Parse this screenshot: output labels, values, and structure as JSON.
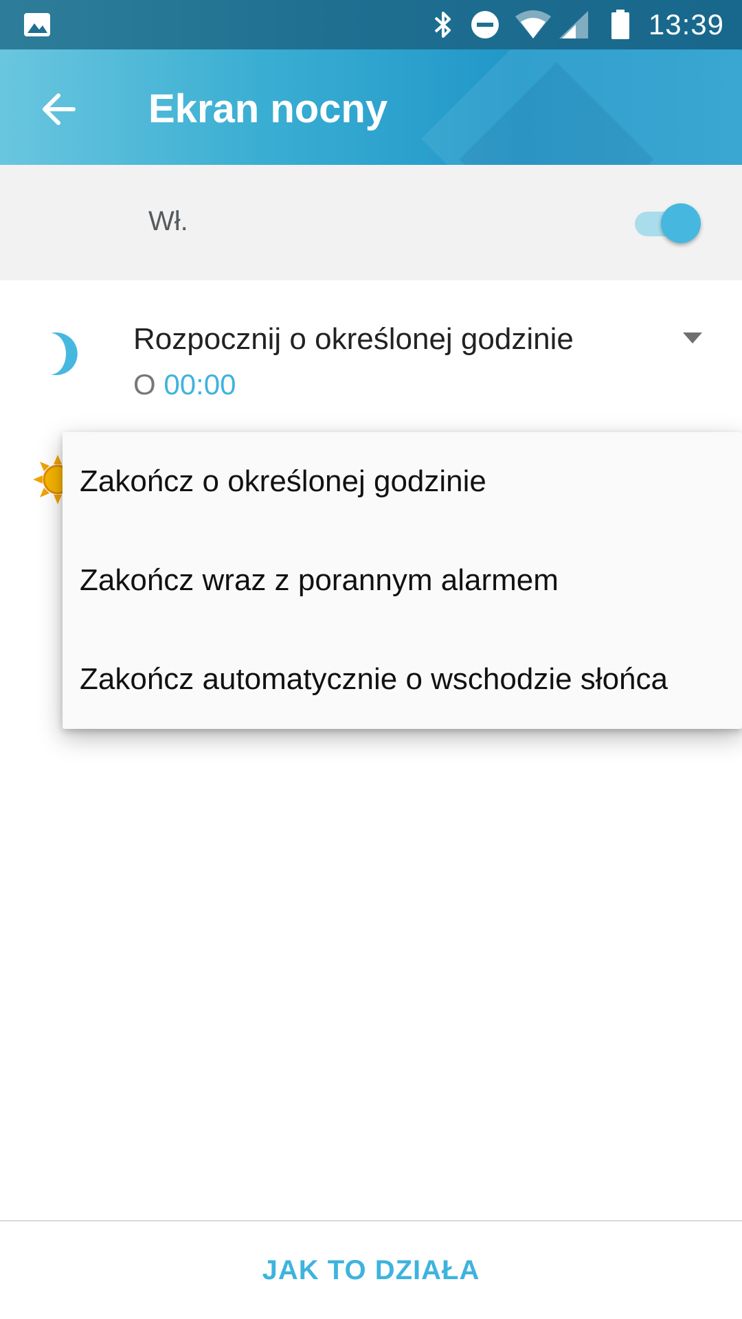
{
  "status_bar": {
    "time": "13:39",
    "icons": [
      "image-notification-icon",
      "bluetooth-icon",
      "do-not-disturb-icon",
      "wifi-icon",
      "cell-signal-icon",
      "battery-icon"
    ]
  },
  "app_bar": {
    "title": "Ekran nocny",
    "back_icon": "arrow-back-icon"
  },
  "master_switch": {
    "label": "Wł.",
    "on": true
  },
  "start_setting": {
    "title": "Rozpocznij o określonej godzinie",
    "prefix": "O",
    "time": "00:00",
    "icon": "moon-icon"
  },
  "end_setting": {
    "icon": "sun-icon"
  },
  "popup_menu": {
    "items": [
      {
        "label": "Zakończ o określonej godzinie"
      },
      {
        "label": "Zakończ wraz z porannym alarmem"
      },
      {
        "label": "Zakończ automatycznie o wschodzie słońca"
      }
    ]
  },
  "footer": {
    "help_label": "JAK TO DZIAŁA"
  },
  "colors": {
    "accent": "#3fb3de",
    "app_bar": "#2197c9",
    "status_bar": "#1f6f91",
    "sun": "#f0a400"
  }
}
